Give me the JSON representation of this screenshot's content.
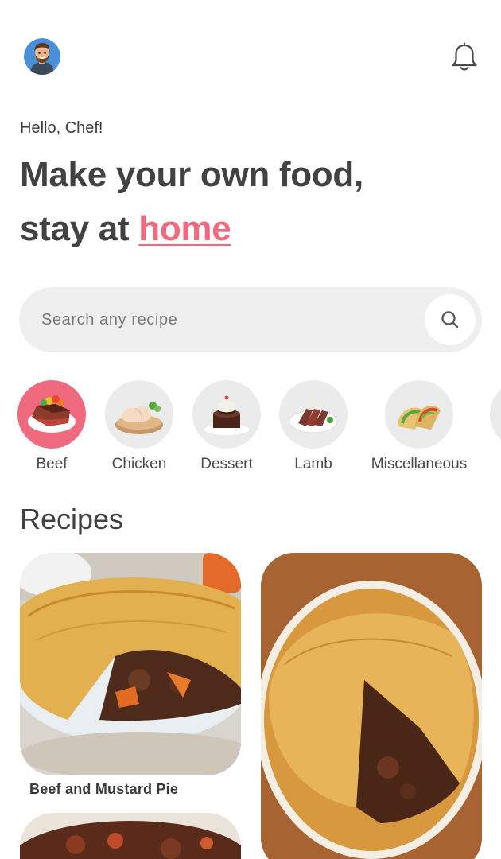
{
  "header": {
    "avatar_icon": "user-avatar",
    "notification_icon": "bell-icon"
  },
  "greeting": "Hello, Chef!",
  "headline": {
    "line1": "Make your own food,",
    "line2_prefix": "stay at ",
    "line2_accent": "home"
  },
  "search": {
    "placeholder": "Search any recipe",
    "value": "",
    "icon": "search-icon"
  },
  "categories": [
    {
      "label": "Beef",
      "active": true
    },
    {
      "label": "Chicken",
      "active": false
    },
    {
      "label": "Dessert",
      "active": false
    },
    {
      "label": "Lamb",
      "active": false
    },
    {
      "label": "Miscellaneous",
      "active": false
    }
  ],
  "section_title": "Recipes",
  "recipes": [
    {
      "title": "Beef and Mustard Pie"
    },
    {
      "title": ""
    },
    {
      "title": ""
    }
  ],
  "colors": {
    "accent": "#f06a7f",
    "search_bg": "#efefef",
    "category_bg": "#ebebeb",
    "text": "#424242"
  }
}
